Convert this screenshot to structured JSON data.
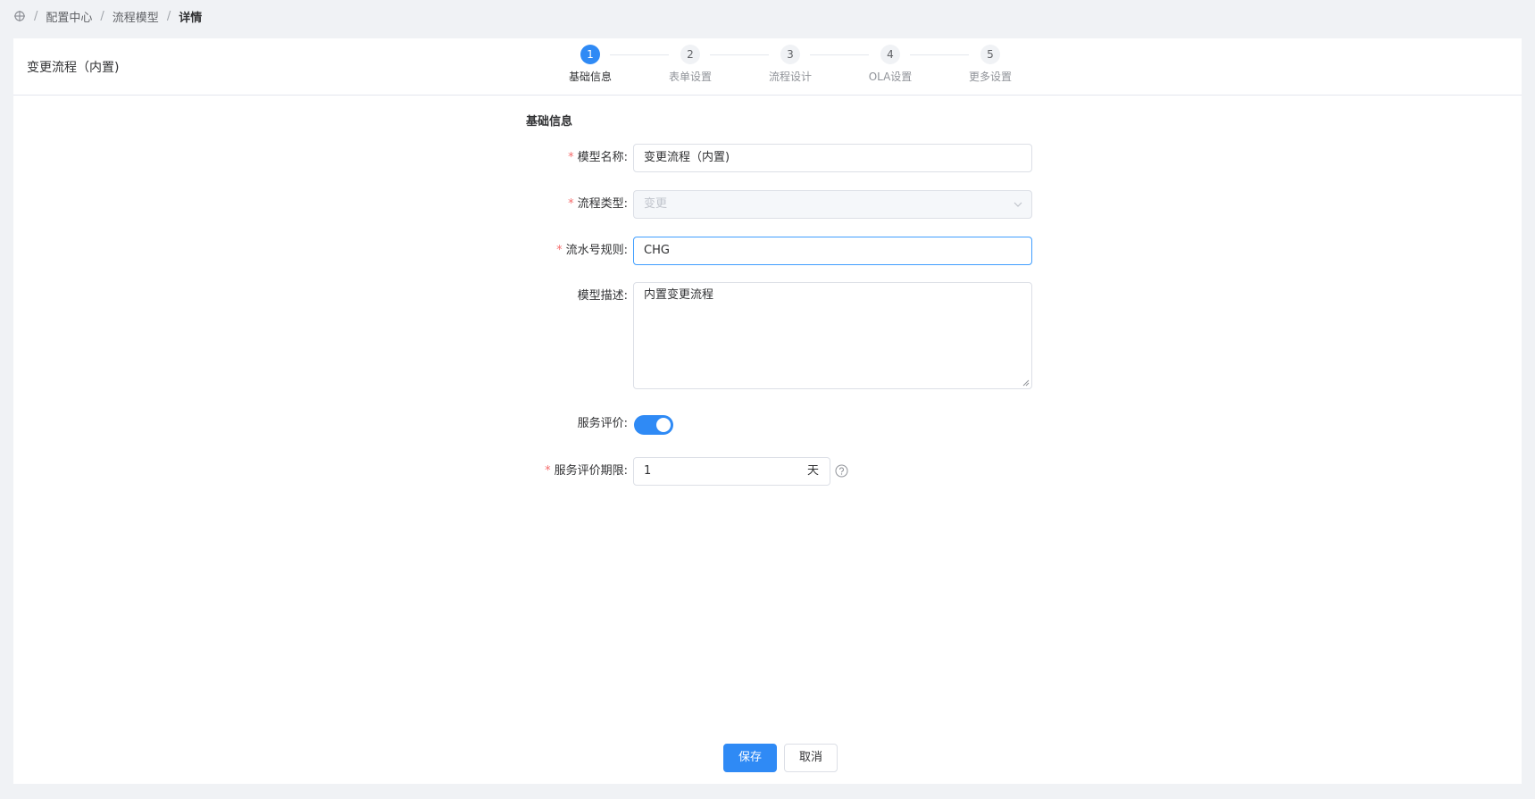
{
  "breadcrumb": {
    "icon": "crosshair-icon",
    "items": [
      "配置中心",
      "流程模型",
      "详情"
    ],
    "separator": "/"
  },
  "header": {
    "title": "变更流程（内置)"
  },
  "steps": [
    {
      "number": "1",
      "label": "基础信息",
      "active": true
    },
    {
      "number": "2",
      "label": "表单设置",
      "active": false
    },
    {
      "number": "3",
      "label": "流程设计",
      "active": false
    },
    {
      "number": "4",
      "label": "OLA设置",
      "active": false
    },
    {
      "number": "5",
      "label": "更多设置",
      "active": false
    }
  ],
  "form": {
    "section_title": "基础信息",
    "required_mark": "*",
    "model_name": {
      "label": "模型名称:",
      "value": "变更流程（内置)"
    },
    "process_type": {
      "label": "流程类型:",
      "value": "变更"
    },
    "serial_rule": {
      "label": "流水号规则:",
      "value": "CHG"
    },
    "description": {
      "label": "模型描述:",
      "value": "内置变更流程"
    },
    "service_rating": {
      "label": "服务评价:",
      "enabled": true
    },
    "rating_period": {
      "label": "服务评价期限:",
      "value": "1",
      "unit": "天"
    }
  },
  "actions": {
    "save": "保存",
    "cancel": "取消"
  },
  "colors": {
    "primary": "#2f8af5",
    "required": "#f56c6c"
  }
}
